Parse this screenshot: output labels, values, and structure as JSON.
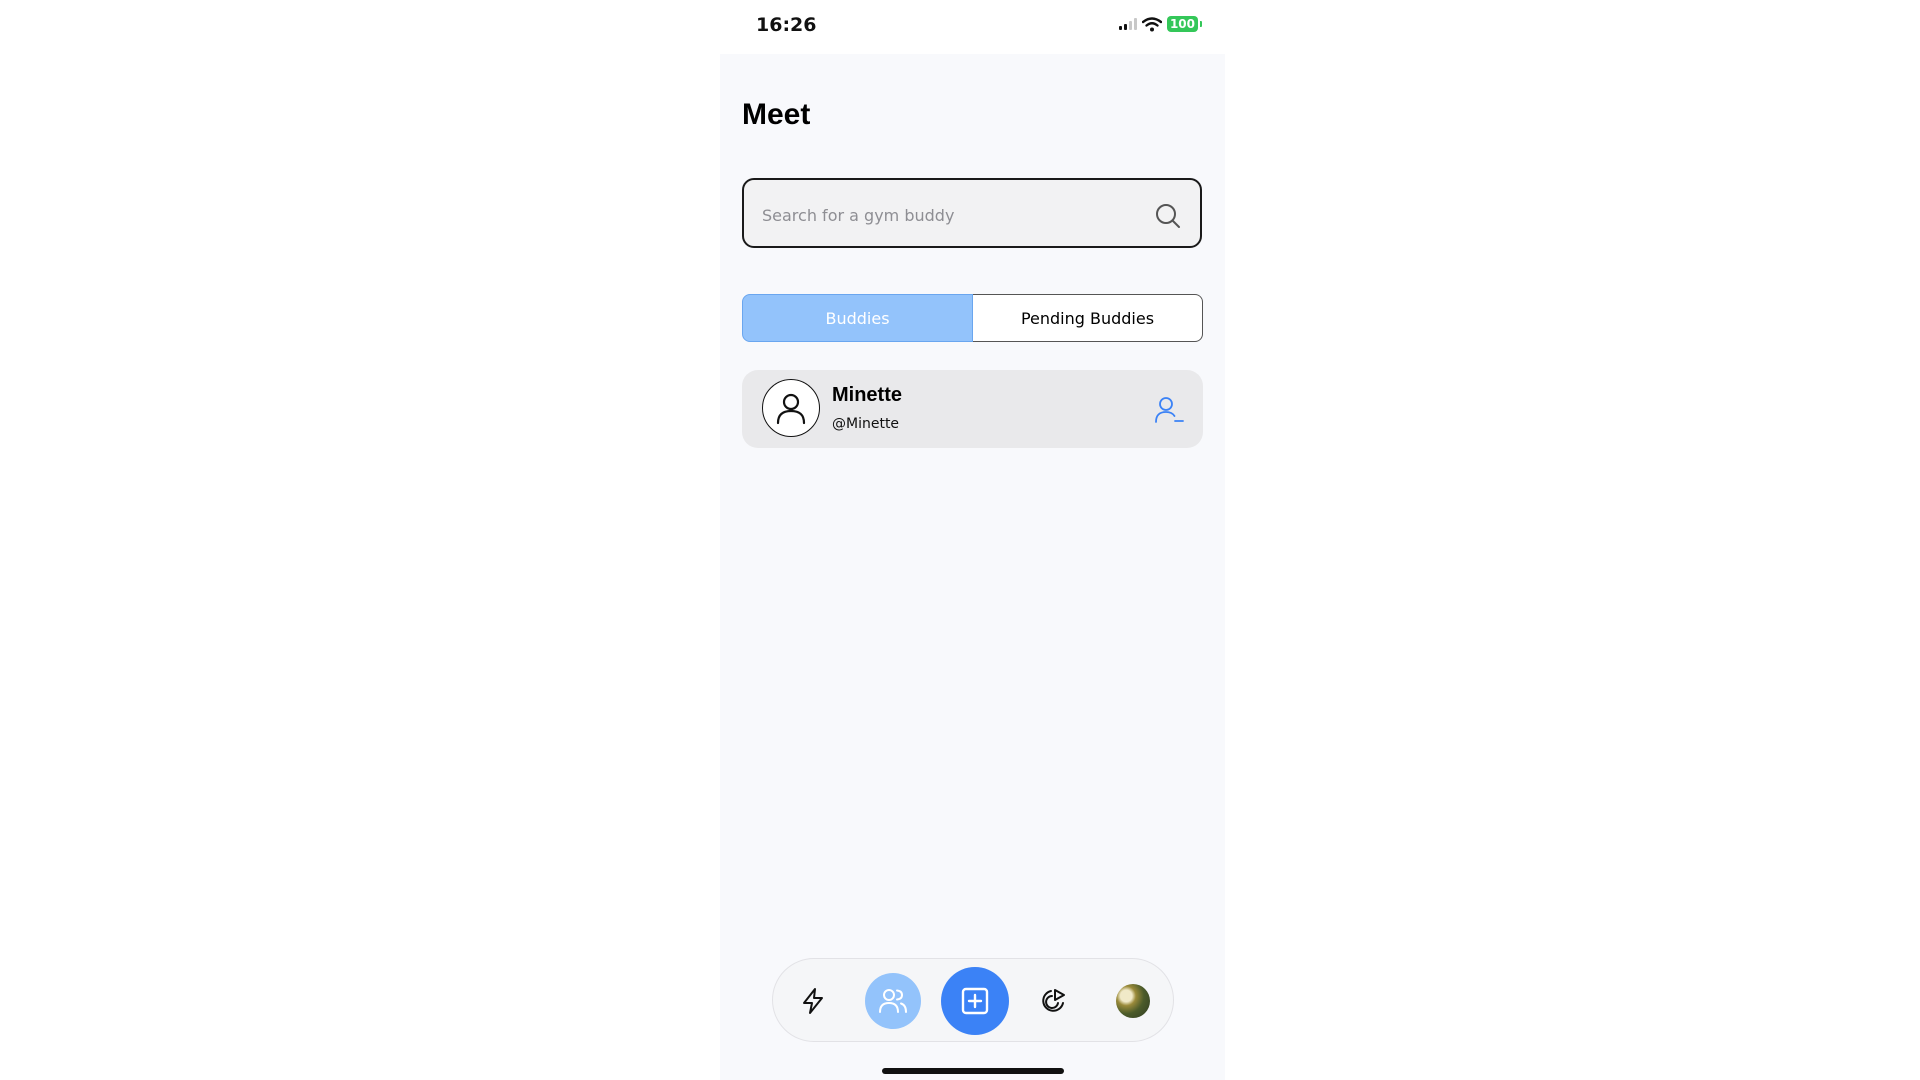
{
  "status_bar": {
    "time": "16:26",
    "battery": "100"
  },
  "page": {
    "title": "Meet"
  },
  "search": {
    "placeholder": "Search for a gym buddy",
    "value": "",
    "icon": "search-icon"
  },
  "tabs": [
    {
      "label": "Buddies",
      "active": true
    },
    {
      "label": "Pending Buddies",
      "active": false
    }
  ],
  "buddies": [
    {
      "name": "Minette",
      "handle": "@Minette",
      "action_icon": "remove-user-icon"
    }
  ],
  "nav": {
    "items": [
      "bolt-icon",
      "buddies-icon",
      "add-icon",
      "stats-icon",
      "profile-avatar"
    ],
    "active": "buddies-icon"
  },
  "colors": {
    "accent": "#3b82f6",
    "accent_light": "#93c3fb",
    "battery": "#34c759",
    "card": "#e9e9eb"
  }
}
